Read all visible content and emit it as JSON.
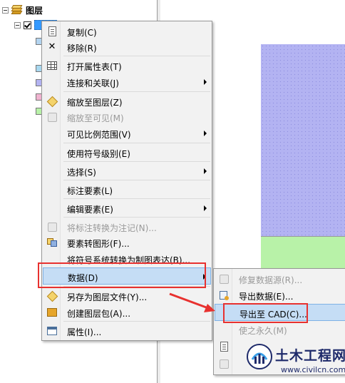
{
  "toc": {
    "root_label": "图层",
    "legend_swatches": [
      {
        "color": "#b3d4f0"
      },
      {
        "color": "#a8d8f0"
      },
      {
        "color": "#b3b3f2"
      },
      {
        "color": "#f0b3d0"
      },
      {
        "color": "#b8f2a8"
      }
    ]
  },
  "context_menu": {
    "items": [
      {
        "label": "复制(C)",
        "icon": "copy-icon"
      },
      {
        "label": "移除(R)",
        "icon": "remove-icon"
      },
      {
        "label": "打开属性表(T)",
        "icon": "table-icon"
      },
      {
        "label": "连接和关联(J)",
        "icon": "",
        "submenu": true
      },
      {
        "label": "缩放至图层(Z)",
        "icon": "zoom-layer-icon"
      },
      {
        "label": "缩放至可见(M)",
        "icon": "zoom-visible-icon",
        "disabled": true
      },
      {
        "label": "可见比例范围(V)",
        "icon": "",
        "submenu": true
      },
      {
        "label": "使用符号级别(E)",
        "icon": ""
      },
      {
        "label": "选择(S)",
        "icon": "",
        "submenu": true
      },
      {
        "label": "标注要素(L)",
        "icon": ""
      },
      {
        "label": "编辑要素(E)",
        "icon": "",
        "submenu": true
      },
      {
        "label": "将标注转换为注记(N)...",
        "icon": "convert-label-icon",
        "disabled": true
      },
      {
        "label": "要素转图形(F)...",
        "icon": "feature-to-graphic-icon"
      },
      {
        "label": "将符号系统转换为制图表达(B)...",
        "icon": ""
      },
      {
        "label": "数据(D)",
        "icon": "",
        "submenu": true,
        "highlighted": true
      },
      {
        "label": "另存为图层文件(Y)...",
        "icon": "layer-file-icon"
      },
      {
        "label": "创建图层包(A)...",
        "icon": "layer-package-icon"
      },
      {
        "label": "属性(I)...",
        "icon": "properties-icon"
      }
    ]
  },
  "data_submenu": {
    "items": [
      {
        "label": "修复数据源(R)...",
        "icon": "repair-source-icon",
        "disabled": true
      },
      {
        "label": "导出数据(E)...",
        "icon": "export-data-icon"
      },
      {
        "label": "导出至 CAD(C)...",
        "icon": "",
        "highlighted": true
      },
      {
        "label": "使之永久(M)",
        "icon": "",
        "disabled": true
      },
      {
        "label": "",
        "icon": "view-metadata-icon"
      },
      {
        "label": "",
        "icon": "review-icon"
      }
    ]
  },
  "watermark": {
    "title": "土木工程网",
    "url": "www.civilcn.com"
  },
  "colors": {
    "highlight": "#c5ddf5",
    "annotation_red": "#e8312f",
    "map_blue": "#b3b3f2",
    "map_green": "#b8f2a8"
  }
}
